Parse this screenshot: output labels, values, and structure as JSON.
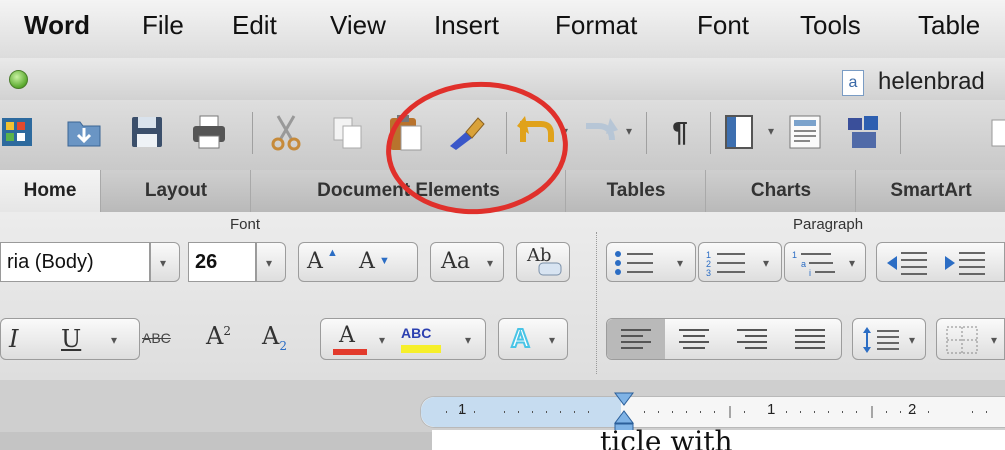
{
  "menubar": {
    "items": [
      "Word",
      "File",
      "Edit",
      "View",
      "Insert",
      "Format",
      "Font",
      "Tools",
      "Table"
    ]
  },
  "window": {
    "title": "helenbrad",
    "doc_icon_glyph": "a"
  },
  "toolbar": {
    "icons": [
      "gallery-icon",
      "templates-icon",
      "save-icon",
      "print-icon",
      "cut-icon",
      "copy-icon",
      "paste-icon",
      "format-painter-icon",
      "undo-icon",
      "redo-icon",
      "pilcrow-icon",
      "sidebar-icon",
      "media-browser-icon",
      "toolbox-icon"
    ],
    "pilcrow": "¶"
  },
  "tabs": [
    {
      "label": "Home",
      "active": true
    },
    {
      "label": "Layout",
      "active": false
    },
    {
      "label": "Document Elements",
      "active": false
    },
    {
      "label": "Tables",
      "active": false
    },
    {
      "label": "Charts",
      "active": false
    },
    {
      "label": "SmartArt",
      "active": false
    }
  ],
  "ribbon": {
    "font_group": {
      "label": "Font",
      "font_name": "ria (Body)",
      "font_size": "26",
      "grow_label": "A",
      "shrink_label": "A",
      "change_case_label": "Aa",
      "clear_label": "Ab",
      "italic": "I",
      "underline": "U",
      "strike": "ABC",
      "superscript": "A",
      "superscript_mark": "2",
      "subscript": "A",
      "subscript_mark": "2",
      "font_color_label": "A",
      "highlight_label": "ABC",
      "text_effects_label": "A"
    },
    "paragraph_group": {
      "label": "Paragraph"
    }
  },
  "ruler": {
    "labels": [
      "1",
      "1",
      "2"
    ]
  },
  "document": {
    "text": "ticle with"
  },
  "colors": {
    "annotation": "#e0302b",
    "font_color_bar": "#e23a2c",
    "highlight_bar": "#f6ef2a",
    "effects_accent": "#48c4e6"
  }
}
